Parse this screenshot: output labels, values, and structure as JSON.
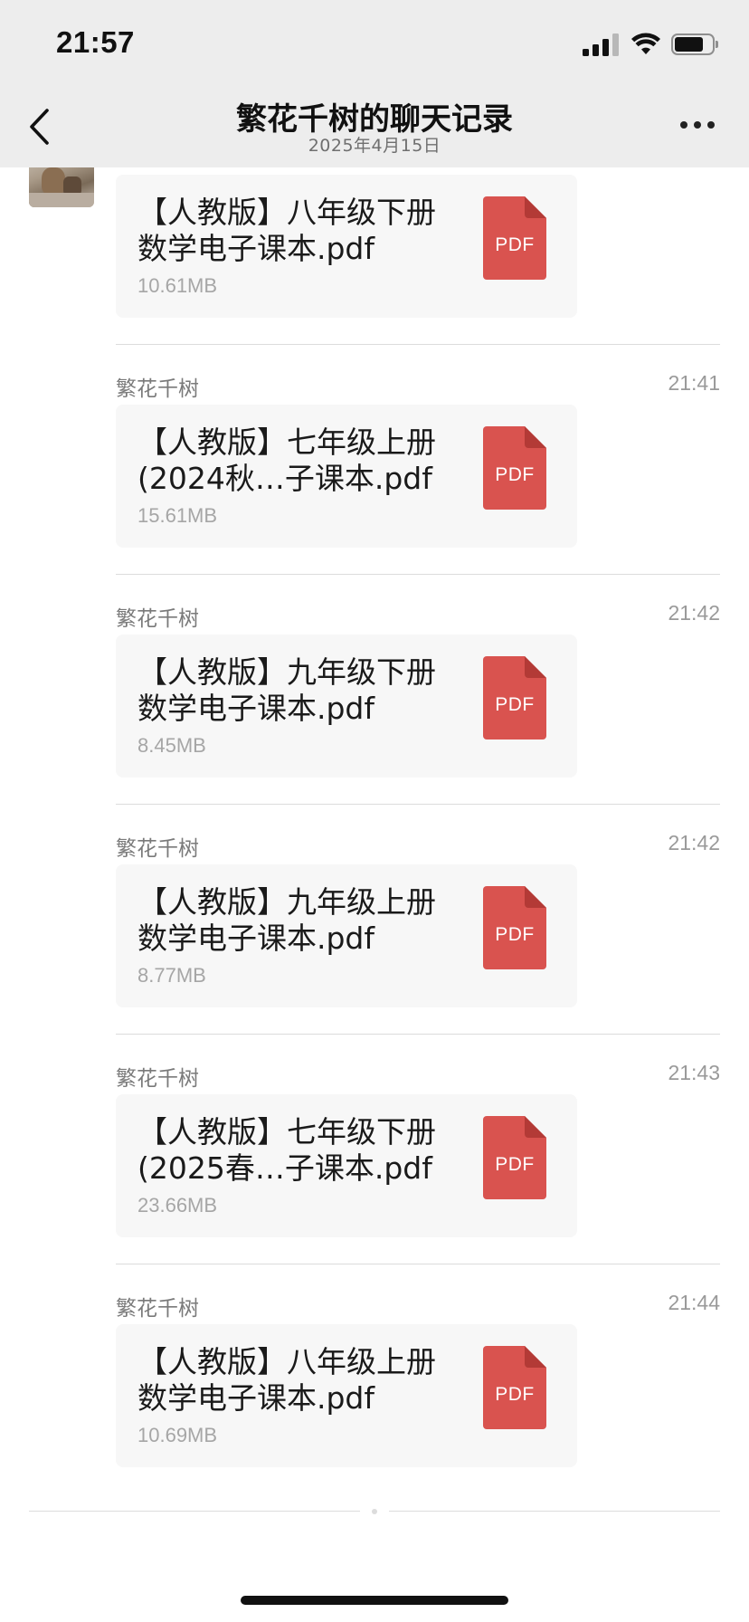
{
  "status_bar": {
    "time": "21:57"
  },
  "nav": {
    "title": "繁花千树的聊天记录",
    "subtitle": "2025年4月15日"
  },
  "messages": [
    {
      "sender": "",
      "time": "",
      "file_name": "【人教版】八年级下册\n数学电子课本.pdf",
      "file_size": "10.61MB",
      "icon_label": "PDF"
    },
    {
      "sender": "繁花千树",
      "time": "21:41",
      "file_name": "【人教版】七年级上册\n(2024秋…子课本.pdf",
      "file_size": "15.61MB",
      "icon_label": "PDF"
    },
    {
      "sender": "繁花千树",
      "time": "21:42",
      "file_name": "【人教版】九年级下册\n数学电子课本.pdf",
      "file_size": "8.45MB",
      "icon_label": "PDF"
    },
    {
      "sender": "繁花千树",
      "time": "21:42",
      "file_name": "【人教版】九年级上册\n数学电子课本.pdf",
      "file_size": "8.77MB",
      "icon_label": "PDF"
    },
    {
      "sender": "繁花千树",
      "time": "21:43",
      "file_name": "【人教版】七年级下册\n(2025春…子课本.pdf",
      "file_size": "23.66MB",
      "icon_label": "PDF"
    },
    {
      "sender": "繁花千树",
      "time": "21:44",
      "file_name": "【人教版】八年级上册\n数学电子课本.pdf",
      "file_size": "10.69MB",
      "icon_label": "PDF"
    }
  ],
  "colors": {
    "header_bg": "#ededed",
    "card_bg": "#f7f7f7",
    "pdf_red": "#d9534f",
    "pdf_fold": "#b33a36"
  },
  "icons": {
    "back": "chevron-left-icon",
    "more": "more-dots-icon",
    "file": "pdf-file-icon"
  }
}
